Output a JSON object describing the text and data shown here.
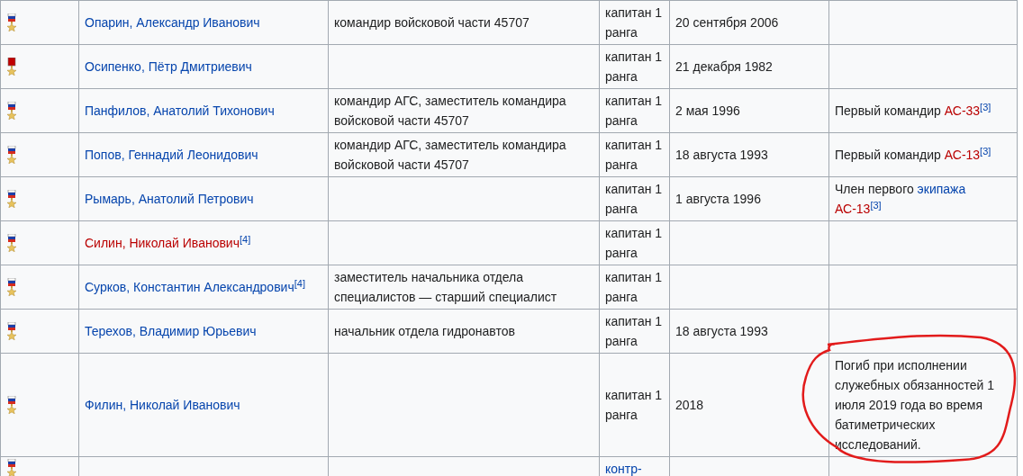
{
  "rows": [
    {
      "soviet_medal": false,
      "name": {
        "text": "Опарин, Александр Иванович",
        "red_link": false
      },
      "post": "командир войсковой части 45707",
      "rank": {
        "text": "капитан 1 ранга",
        "link": false
      },
      "date": "20 сентября 2006",
      "note": []
    },
    {
      "soviet_medal": true,
      "name": {
        "text": "Осипенко, Пётр Дмитриевич",
        "red_link": false
      },
      "post": "",
      "rank": {
        "text": "капитан 1 ранга",
        "link": false
      },
      "date": "21 декабря 1982",
      "note": []
    },
    {
      "soviet_medal": false,
      "name": {
        "text": "Панфилов, Анатолий Тихонович",
        "red_link": false
      },
      "post": "командир АГС, заместитель командира войсковой части 45707",
      "rank": {
        "text": "капитан 1 ранга",
        "link": false
      },
      "date": "2 мая 1996",
      "note": [
        {
          "text": "Первый командир ",
          "kind": "plain"
        },
        {
          "text": "АС-33",
          "kind": "redlink"
        },
        {
          "text": "[3]",
          "kind": "ref"
        }
      ]
    },
    {
      "soviet_medal": false,
      "name": {
        "text": "Попов, Геннадий Леонидович",
        "red_link": false
      },
      "post": "командир АГС, заместитель командира войсковой части 45707",
      "rank": {
        "text": "капитан 1 ранга",
        "link": false
      },
      "date": "18 августа 1993",
      "note": [
        {
          "text": "Первый командир ",
          "kind": "plain"
        },
        {
          "text": "АС-13",
          "kind": "redlink"
        },
        {
          "text": "[3]",
          "kind": "ref"
        }
      ]
    },
    {
      "soviet_medal": false,
      "name": {
        "text": "Рымарь, Анатолий Петрович",
        "red_link": false
      },
      "post": "",
      "rank": {
        "text": "капитан 1 ранга",
        "link": false
      },
      "date": "1 августа 1996",
      "note": [
        {
          "text": "Член первого ",
          "kind": "plain"
        },
        {
          "text": "экипажа ",
          "kind": "link"
        },
        {
          "text": "АС-13",
          "kind": "redlink"
        },
        {
          "text": "[3]",
          "kind": "ref"
        }
      ]
    },
    {
      "soviet_medal": false,
      "name": {
        "text": "Силин, Николай Иванович",
        "red_link": true,
        "ref": "[4]"
      },
      "post": "",
      "rank": {
        "text": "капитан 1 ранга",
        "link": false
      },
      "date": "",
      "note": []
    },
    {
      "soviet_medal": false,
      "name": {
        "text": "Сурков, Константин Александрович",
        "red_link": false,
        "ref": "[4]"
      },
      "post": "заместитель начальника отдела специалистов — старший специалист",
      "rank": {
        "text": "капитан 1 ранга",
        "link": false
      },
      "date": "",
      "note": []
    },
    {
      "soviet_medal": false,
      "name": {
        "text": "Терехов, Владимир Юрьевич",
        "red_link": false
      },
      "post": "начальник отдела гидронавтов",
      "rank": {
        "text": "капитан 1 ранга",
        "link": false
      },
      "date": "18 августа 1993",
      "note": []
    },
    {
      "soviet_medal": false,
      "name": {
        "text": "Филин, Николай Иванович",
        "red_link": false
      },
      "post": "",
      "rank": {
        "text": "капитан 1 ранга",
        "link": false
      },
      "date": "2018",
      "note": [
        {
          "text": "Погиб при исполнении служебных обязанностей 1 июля 2019 года во время батиметрических исследований.",
          "kind": "plain"
        }
      ],
      "circled": true
    },
    {
      "soviet_medal": false,
      "post": "",
      "rank": {
        "text": "контр-",
        "link": true
      },
      "date": "",
      "note": []
    }
  ]
}
